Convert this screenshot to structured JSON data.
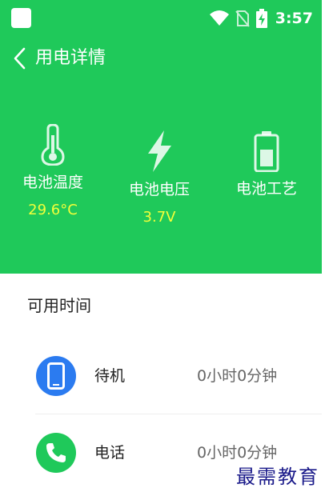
{
  "status_bar": {
    "time": "3:57",
    "icons": [
      "app-icon",
      "wifi-icon",
      "no-sim-icon",
      "battery-charging-icon"
    ]
  },
  "title_bar": {
    "back_icon": "chevron-left-icon",
    "title": "用电详情"
  },
  "stats": [
    {
      "icon": "thermometer-icon",
      "label": "电池温度",
      "value": "29.6°C"
    },
    {
      "icon": "lightning-icon",
      "label": "电池电压",
      "value": "3.7V"
    },
    {
      "icon": "battery-icon",
      "label": "电池工艺",
      "value": ""
    }
  ],
  "available_time": {
    "title": "可用时间",
    "rows": [
      {
        "icon": "phone-device-icon",
        "name": "待机",
        "time": "0小时0分钟",
        "color": "#2b7bf0"
      },
      {
        "icon": "phone-call-icon",
        "name": "电话",
        "time": "0小时0分钟",
        "color": "#1fc95a"
      }
    ]
  },
  "colors": {
    "header_bg": "#1fc95a",
    "value_text": "#f2ff3a"
  },
  "watermark": "最需教育"
}
